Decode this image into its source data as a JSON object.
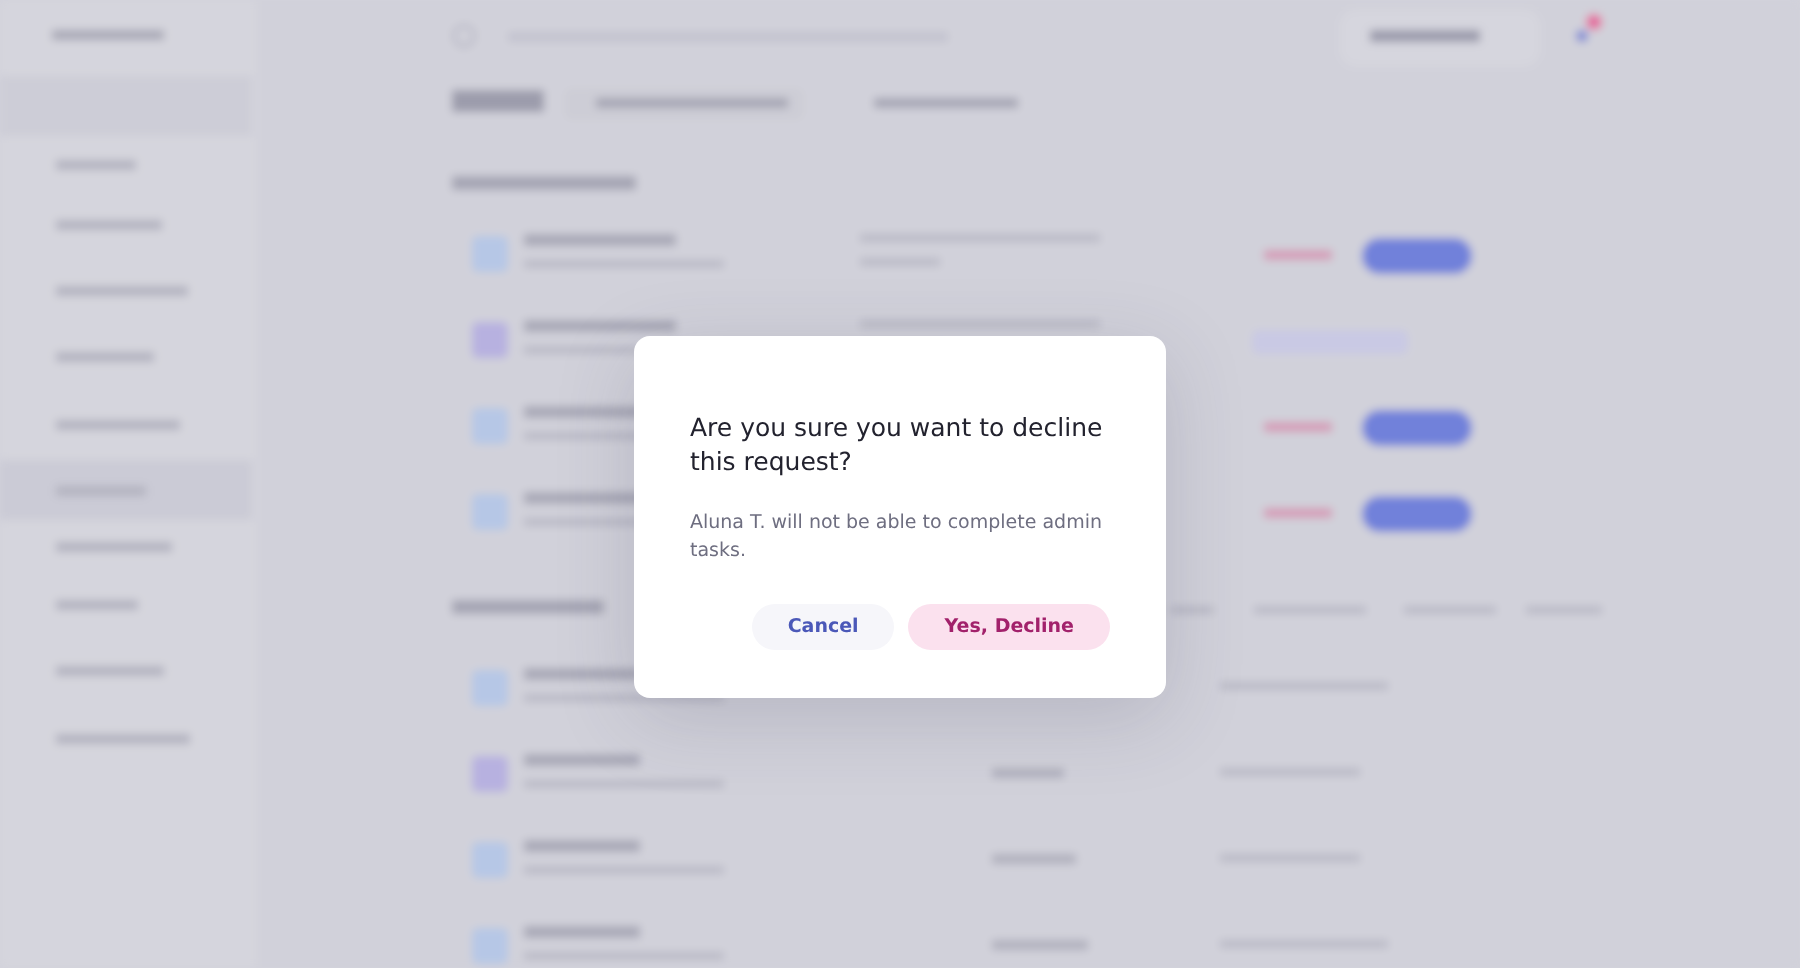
{
  "dialog": {
    "title": "Are you sure you want to decline this request?",
    "message": "Aluna T. will not be able to complete admin tasks.",
    "buttons": [
      {
        "label": "Cancel",
        "kind": "secondary"
      },
      {
        "label": "Yes, Decline",
        "kind": "danger"
      }
    ]
  }
}
